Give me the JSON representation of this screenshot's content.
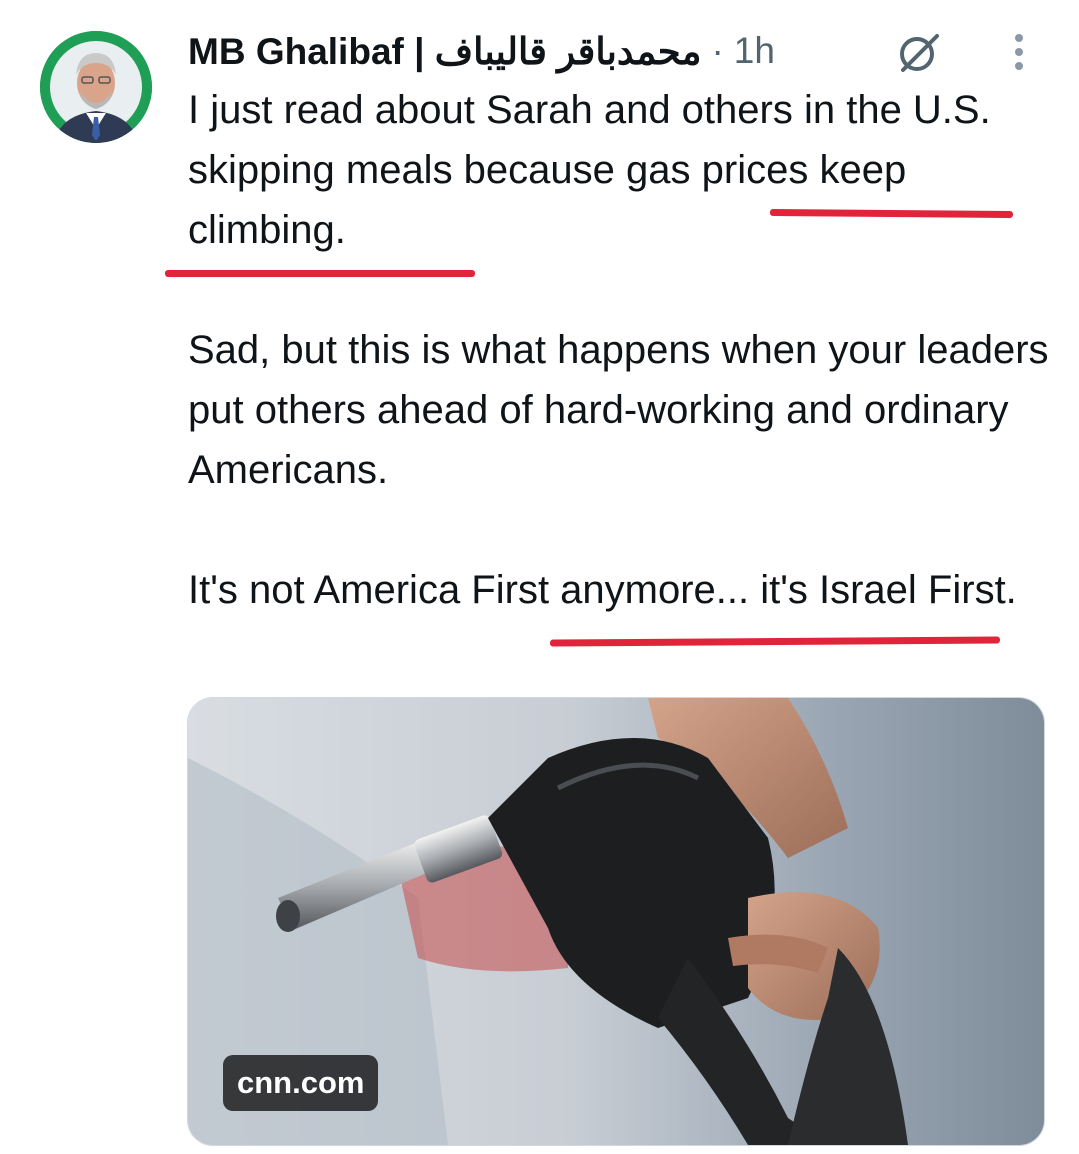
{
  "tweet": {
    "author_name": "MB Ghalibaf | محمدباقر قالیباف",
    "separator": "·",
    "time": "1h",
    "paragraphs": [
      "I just read about Sarah and others in the U.S. skipping meals because gas prices keep climbing.",
      "Sad, but this is what happens when your leaders put others ahead of hard-working and ordinary Americans.",
      "It's not America First anymore... it's Israel First."
    ]
  },
  "card": {
    "domain": "cnn.com"
  },
  "icons": {
    "avatar": "profile-photo",
    "grok": "grok-icon",
    "more": "more-vertical-icon"
  },
  "colors": {
    "underline": "#e0253a",
    "avatar_bg": "#1f9e55",
    "secondary_text": "#536471"
  }
}
